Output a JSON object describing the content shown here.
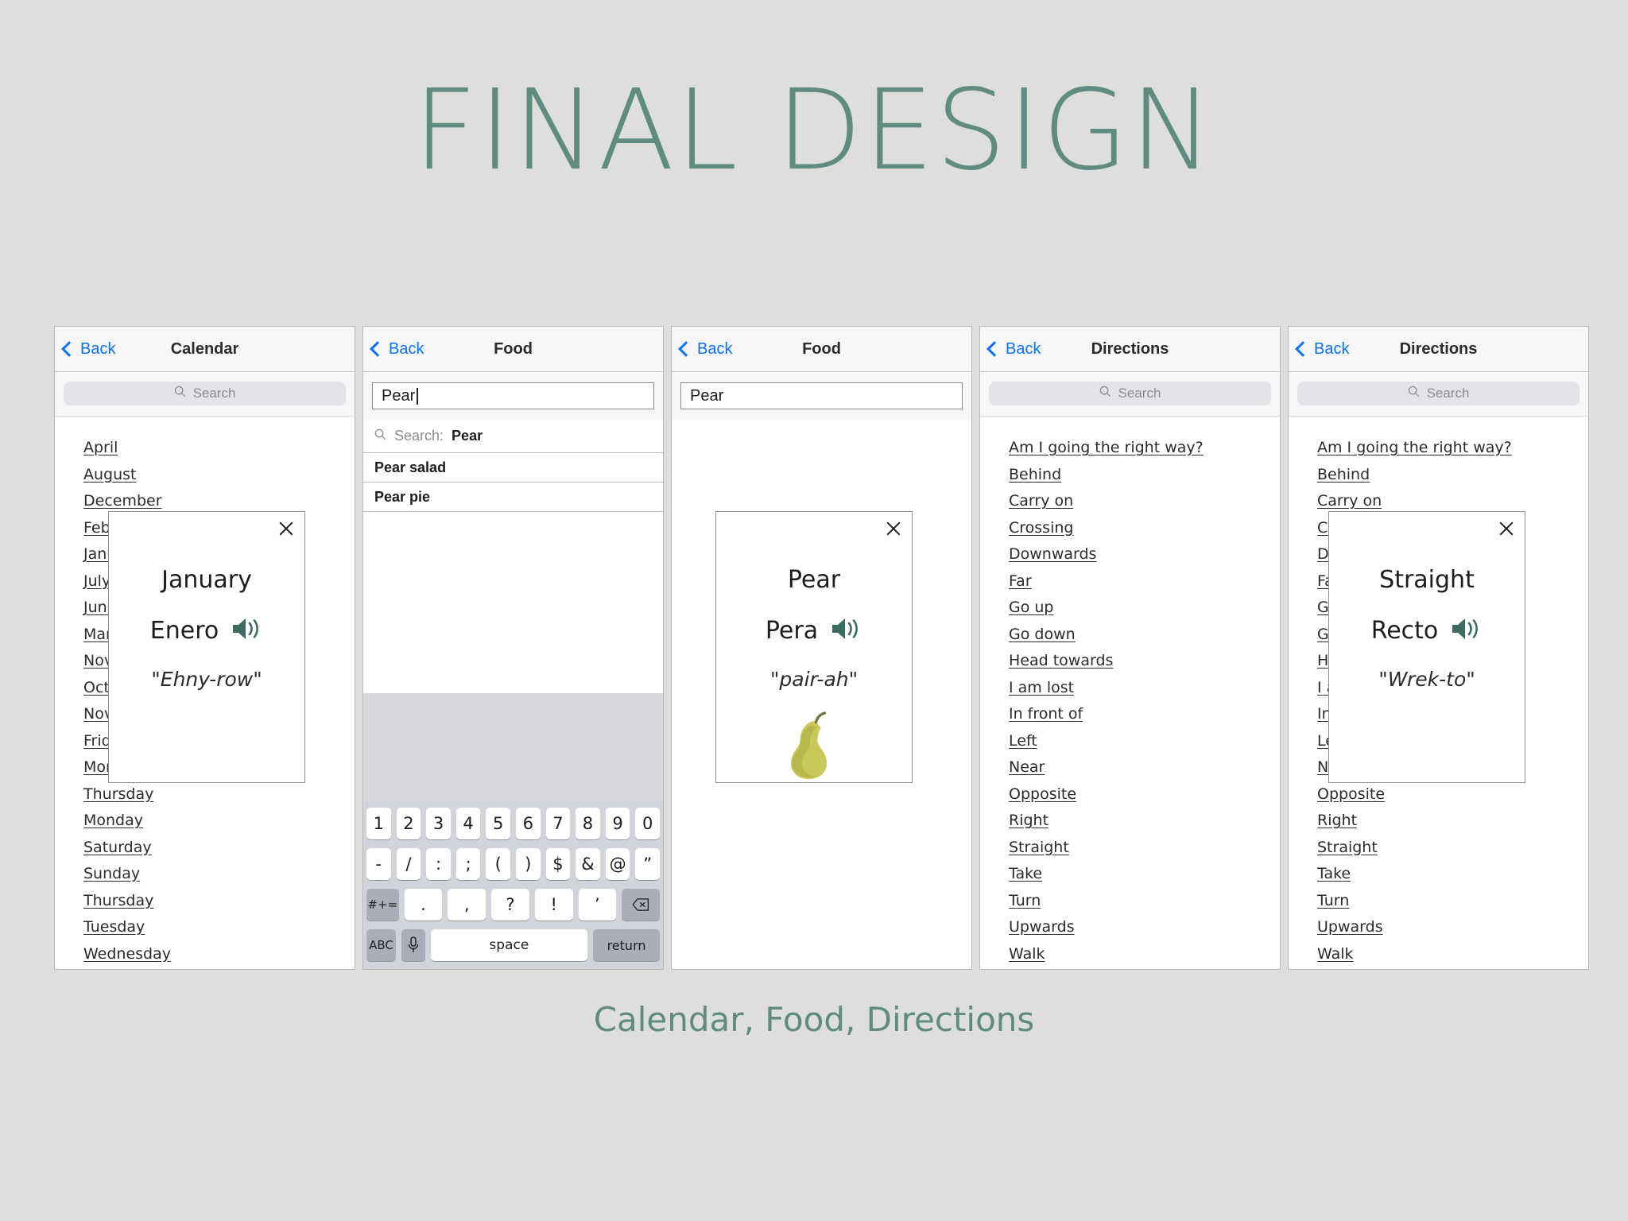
{
  "heading": {
    "title": "FINAL DESIGN",
    "caption": "Calendar, Food, Directions",
    "accent_color": "#5f8b80",
    "background_color": "#dededd"
  },
  "common": {
    "back_label": "Back",
    "search_placeholder": "Search",
    "speaker_color": "#3d6b62"
  },
  "screens": [
    {
      "id": "calendar",
      "nav_title": "Calendar",
      "search_placeholder": "Search",
      "list": [
        "April",
        "August",
        "December",
        "February",
        "January",
        "July",
        "June",
        "March",
        "November",
        "October",
        "November",
        "Friday",
        "Monday",
        "Thursday",
        "Monday",
        "Saturday",
        "Sunday",
        "Thursday",
        "Tuesday",
        "Wednesday"
      ],
      "modal": {
        "english": "January",
        "spanish": "Enero",
        "phonetic": "\"Ehny-row\"",
        "close_label": "×"
      }
    },
    {
      "id": "food-keyboard",
      "nav_title": "Food",
      "field_value": "Pear",
      "suggest_prefix": "Search: ",
      "suggest_query": "Pear",
      "suggestions": [
        "Pear salad",
        "Pear pie"
      ],
      "keyboard": {
        "row1": [
          "1",
          "2",
          "3",
          "4",
          "5",
          "6",
          "7",
          "8",
          "9",
          "0"
        ],
        "row2": [
          "-",
          "/",
          ":",
          ";",
          "(",
          ")",
          "$",
          "&",
          "@",
          "”"
        ],
        "row3": [
          "#+=",
          ".",
          ",",
          "?",
          "!",
          "’",
          "⌫"
        ],
        "row4": [
          "ABC",
          "🎙",
          "space",
          "return"
        ],
        "space_label": "space",
        "return_label": "return",
        "abc_label": "ABC",
        "sym_label": "#+=",
        "mic_label": "mic-icon",
        "backspace_label": "backspace-icon"
      }
    },
    {
      "id": "food-result",
      "nav_title": "Food",
      "field_value": "Pear",
      "modal": {
        "english": "Pear",
        "spanish": "Pera",
        "phonetic": "\"pair-ah\"",
        "image": "pear-illustration",
        "close_label": "×"
      }
    },
    {
      "id": "directions",
      "nav_title": "Directions",
      "search_placeholder": "Search",
      "list": [
        "Am I going the right way?",
        "Behind",
        "Carry on",
        "Crossing",
        "Downwards",
        "Far",
        "Go up",
        "Go down",
        "Head towards",
        "I am lost",
        "In front of",
        "Left",
        "Near",
        "Opposite",
        "Right",
        "Straight",
        "Take",
        "Turn",
        "Upwards",
        "Walk"
      ]
    },
    {
      "id": "directions-modal",
      "nav_title": "Directions",
      "search_placeholder": "Search",
      "list": [
        "Am I going the right way?",
        "Behind",
        "Carry on",
        "Crossing",
        "Downwards",
        "Far",
        "Go up",
        "Go down",
        "Head towards",
        "I am lost",
        "In front of",
        "Left",
        "Near",
        "Opposite",
        "Right",
        "Straight",
        "Take",
        "Turn",
        "Upwards",
        "Walk"
      ],
      "modal": {
        "english": "Straight",
        "spanish": "Recto",
        "phonetic": "\"Wrek-to\"",
        "close_label": "×"
      }
    }
  ]
}
